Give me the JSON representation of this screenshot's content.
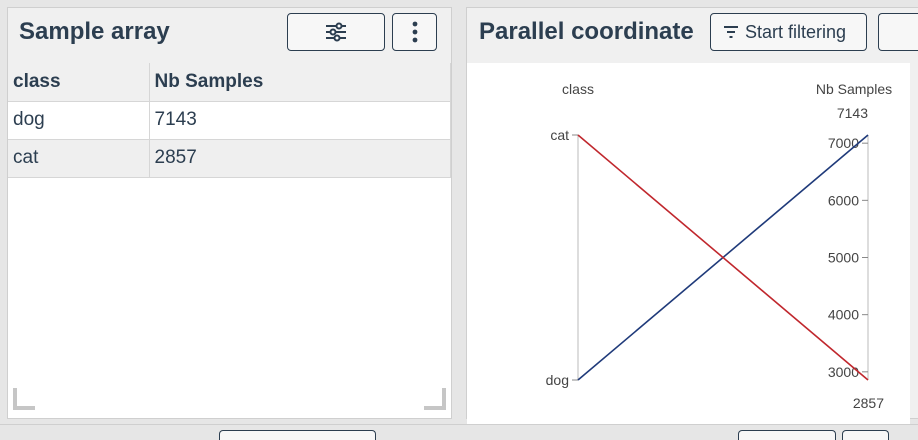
{
  "left_panel": {
    "title": "Sample array",
    "settings_icon": "sliders-icon",
    "menu_icon": "vertical-dots-icon",
    "table": {
      "columns": [
        "class",
        "Nb Samples"
      ],
      "rows": [
        [
          "dog",
          "7143"
        ],
        [
          "cat",
          "2857"
        ]
      ]
    }
  },
  "right_panel": {
    "title": "Parallel coordinate",
    "filter_button_label": "Start filtering",
    "filter_icon": "filter-lines-icon"
  },
  "chart_data": {
    "type": "parallel-coordinates",
    "axes": [
      {
        "name": "class",
        "type": "categorical",
        "categories": [
          "dog",
          "cat"
        ]
      },
      {
        "name": "Nb Samples",
        "type": "numeric",
        "min": 2857,
        "max": 7143,
        "ticks": [
          3000,
          4000,
          5000,
          6000,
          7000
        ],
        "min_label": "2857",
        "max_label": "7143"
      }
    ],
    "lines": [
      {
        "class": "dog",
        "Nb Samples": 7143,
        "color": "#1f3a7a"
      },
      {
        "class": "cat",
        "Nb Samples": 2857,
        "color": "#c0272d"
      }
    ]
  }
}
